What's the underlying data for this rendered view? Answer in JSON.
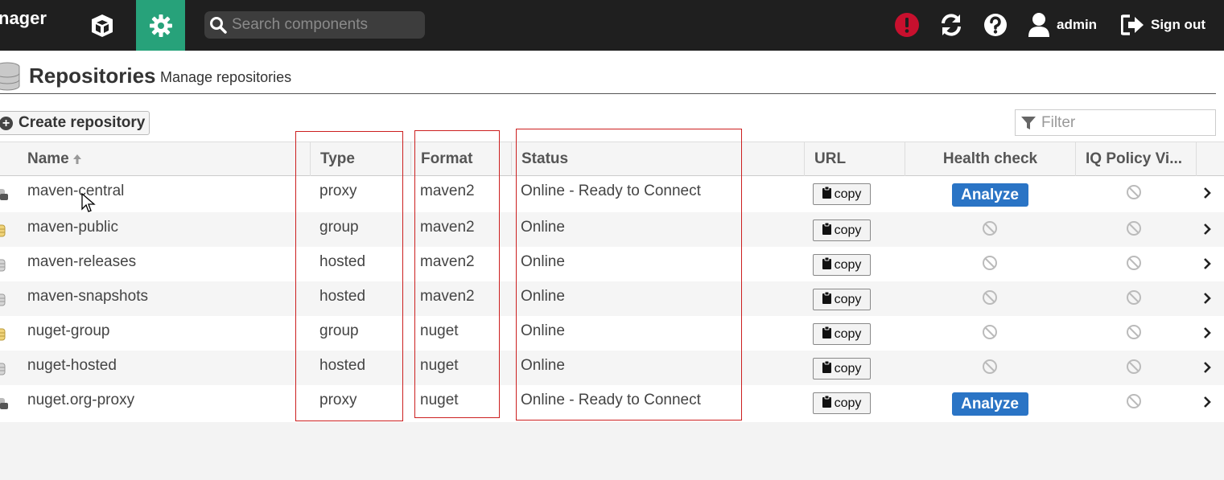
{
  "topbar": {
    "brand": "nager",
    "search_placeholder": "Search components",
    "user_label": "admin",
    "signout_label": "Sign out",
    "accent": "#27a27a"
  },
  "header": {
    "title": "Repositories",
    "subtitle": "Manage repositories"
  },
  "toolbar": {
    "create_label": "Create repository",
    "filter_placeholder": "Filter"
  },
  "columns": {
    "name": "Name",
    "type": "Type",
    "format": "Format",
    "status": "Status",
    "url": "URL",
    "health": "Health check",
    "iq": "IQ Policy Vi..."
  },
  "copy_label": "copy",
  "analyze_label": "Analyze",
  "rows": [
    {
      "name": "maven-central",
      "type": "proxy",
      "format": "maven2",
      "status": "Online - Ready to Connect",
      "health": "analyze",
      "icon": "proxy-repo-icon"
    },
    {
      "name": "maven-public",
      "type": "group",
      "format": "maven2",
      "status": "Online",
      "health": "disabled",
      "icon": "group-repo-icon"
    },
    {
      "name": "maven-releases",
      "type": "hosted",
      "format": "maven2",
      "status": "Online",
      "health": "disabled",
      "icon": "hosted-repo-icon"
    },
    {
      "name": "maven-snapshots",
      "type": "hosted",
      "format": "maven2",
      "status": "Online",
      "health": "disabled",
      "icon": "hosted-repo-icon"
    },
    {
      "name": "nuget-group",
      "type": "group",
      "format": "nuget",
      "status": "Online",
      "health": "disabled",
      "icon": "group-repo-icon"
    },
    {
      "name": "nuget-hosted",
      "type": "hosted",
      "format": "nuget",
      "status": "Online",
      "health": "disabled",
      "icon": "hosted-repo-icon"
    },
    {
      "name": "nuget.org-proxy",
      "type": "proxy",
      "format": "nuget",
      "status": "Online - Ready to Connect",
      "health": "analyze",
      "icon": "proxy-repo-icon"
    }
  ]
}
